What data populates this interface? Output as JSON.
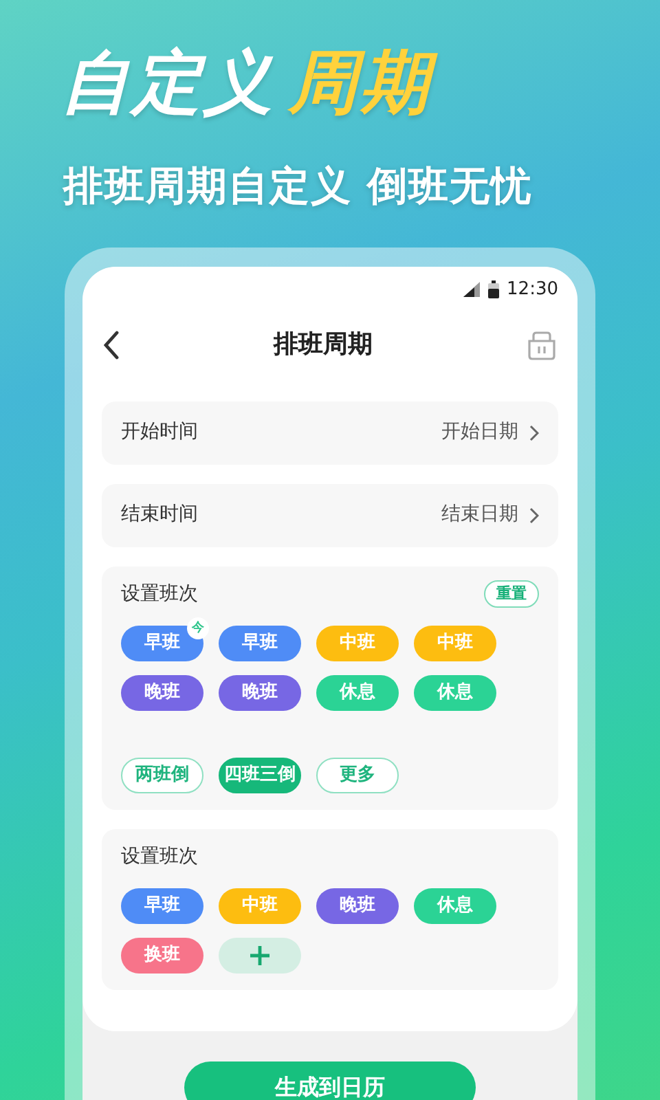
{
  "headline": [
    {
      "text": "自定义",
      "kind": "plain"
    },
    {
      "text": "周期",
      "kind": "accent"
    }
  ],
  "subtitle": "排班周期自定义 倒班无忧",
  "status_bar": {
    "time": "12:30"
  },
  "nav": {
    "title": "排班周期"
  },
  "rows": [
    {
      "label": "开始时间",
      "value": "开始日期"
    },
    {
      "label": "结束时间",
      "value": "结束日期"
    }
  ],
  "sections": [
    {
      "title": "设置班次",
      "reset": "重置",
      "chips": [
        {
          "text": "早班",
          "color": "#4f8cf6",
          "badge": "今"
        },
        {
          "text": "早班",
          "color": "#4f8cf6"
        },
        {
          "text": "中班",
          "color": "#fdbd10"
        },
        {
          "text": "中班",
          "color": "#fdbd10"
        },
        {
          "text": "晚班",
          "color": "#7767e4"
        },
        {
          "text": "晚班",
          "color": "#7767e4"
        },
        {
          "text": "休息",
          "color": "#2bd395"
        },
        {
          "text": "休息",
          "color": "#2bd395"
        }
      ],
      "patterns": [
        {
          "text": "两班倒",
          "selected": false
        },
        {
          "text": "四班三倒",
          "selected": true
        },
        {
          "text": "更多",
          "selected": false
        }
      ]
    },
    {
      "title": "设置班次",
      "chips": [
        {
          "text": "早班",
          "color": "#4f8cf6"
        },
        {
          "text": "中班",
          "color": "#fdbd10"
        },
        {
          "text": "晚班",
          "color": "#7767e4"
        },
        {
          "text": "休息",
          "color": "#2bd395"
        },
        {
          "text": "换班",
          "color": "#f7748a"
        }
      ],
      "add": true
    }
  ],
  "action": "生成到日历"
}
